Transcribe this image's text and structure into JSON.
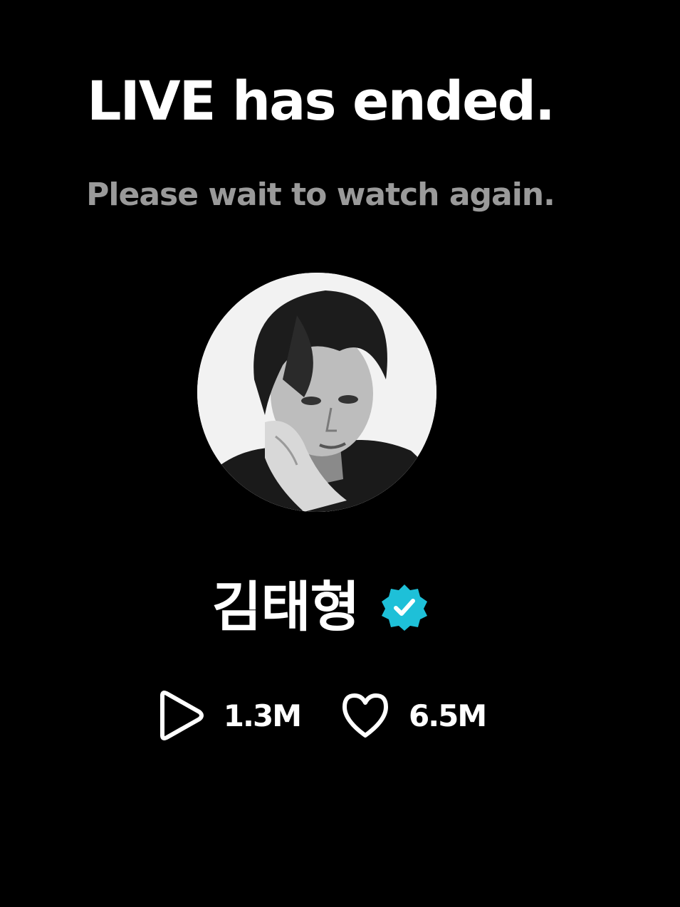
{
  "live_status": {
    "title": "LIVE has ended.",
    "subtitle": "Please wait to watch again."
  },
  "creator": {
    "avatar_icon": "creator-avatar",
    "name": "김태형",
    "verified_icon": "verified-badge-icon",
    "verified_color": "#1ec0d8"
  },
  "stats": {
    "plays": {
      "icon": "play-icon",
      "value": "1.3M"
    },
    "likes": {
      "icon": "heart-icon",
      "value": "6.5M"
    }
  },
  "colors": {
    "background": "#000000",
    "title": "#ffffff",
    "subtitle": "#9a9a9a"
  }
}
